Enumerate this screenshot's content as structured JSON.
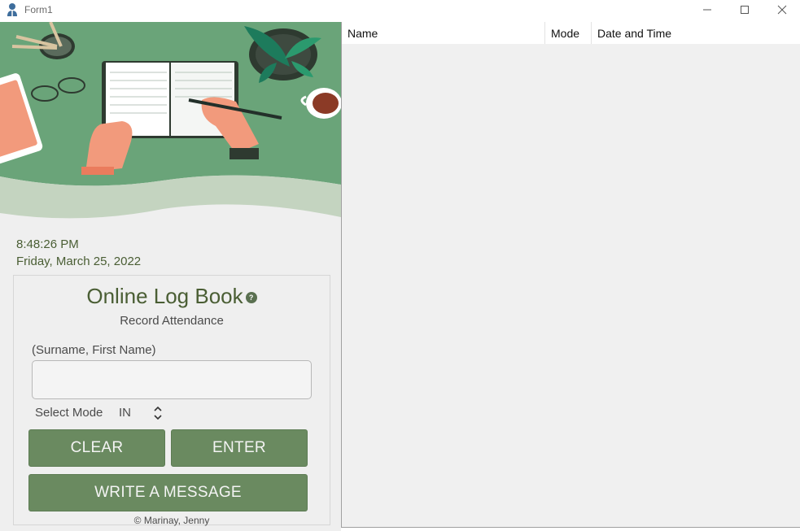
{
  "window": {
    "title": "Form1",
    "controls": {
      "minimize": "–",
      "maximize": "☐",
      "close": "✕"
    }
  },
  "clock": {
    "time": "8:48:26 PM",
    "date": "Friday, March 25, 2022"
  },
  "form": {
    "title": "Online Log Book",
    "subtitle": "Record Attendance",
    "name_label": "(Surname, First Name)",
    "name_value": "",
    "mode_label": "Select Mode",
    "mode_value": "IN",
    "clear_label": "CLEAR",
    "enter_label": "ENTER",
    "message_label": "WRITE A MESSAGE",
    "copyright": "© Marinay, Jenny"
  },
  "table": {
    "columns": [
      "Name",
      "Mode",
      "Date and Time"
    ],
    "rows": []
  },
  "colors": {
    "accent_green": "#6a8a60",
    "text_green": "#4a5e34",
    "hero_green": "#6aa479"
  }
}
